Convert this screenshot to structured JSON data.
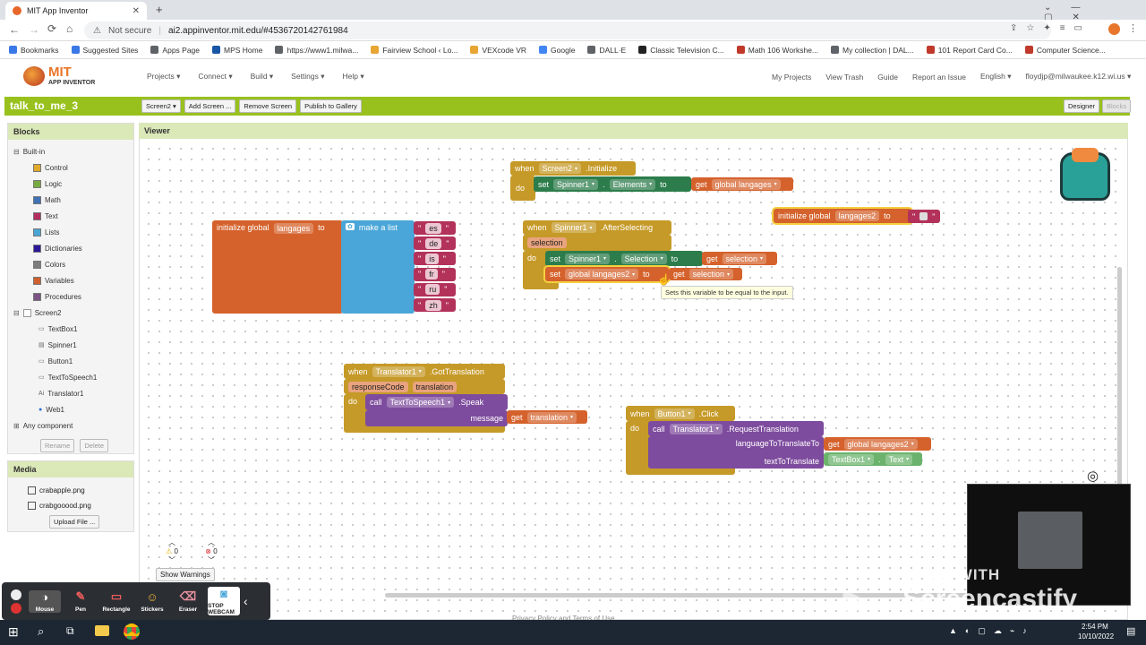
{
  "browser": {
    "tab_title": "MIT App Inventor",
    "security_label": "Not secure",
    "url": "ai2.appinventor.mit.edu/#4536720142761984",
    "bookmarks": [
      {
        "label": "Bookmarks",
        "color": "#3b78e7"
      },
      {
        "label": "Suggested Sites",
        "color": "#3b78e7"
      },
      {
        "label": "Apps Page",
        "color": "#5f6368"
      },
      {
        "label": "MPS Home",
        "color": "#1a56a6"
      },
      {
        "label": "https://www1.milwa...",
        "color": "#5f6368"
      },
      {
        "label": "Fairview School ‹ Lo...",
        "color": "#e7a534"
      },
      {
        "label": "VEXcode VR",
        "color": "#e7a534"
      },
      {
        "label": "Google",
        "color": "#4285f4"
      },
      {
        "label": "DALL·E",
        "color": "#5f6368"
      },
      {
        "label": "Classic Television C...",
        "color": "#222222"
      },
      {
        "label": "Math 106 Workshe...",
        "color": "#c0392b"
      },
      {
        "label": "My collection | DAL...",
        "color": "#5f6368"
      },
      {
        "label": "101 Report Card Co...",
        "color": "#c0392b"
      },
      {
        "label": "Computer Science...",
        "color": "#c0392b"
      }
    ]
  },
  "app": {
    "logo_line1": "MIT",
    "logo_line2": "APP INVENTOR",
    "menus": [
      "Projects ▾",
      "Connect ▾",
      "Build ▾",
      "Settings ▾",
      "Help ▾"
    ],
    "right_links": [
      "My Projects",
      "View Trash",
      "Guide",
      "Report an Issue",
      "English ▾",
      "floydjp@milwaukee.k12.wi.us ▾"
    ],
    "project_name": "talk_to_me_3",
    "screen_dropdown": "Screen2 ▾",
    "add_screen": "Add Screen ...",
    "remove_screen": "Remove Screen",
    "publish": "Publish to Gallery",
    "designer": "Designer",
    "blocks_btn": "Blocks"
  },
  "blocks_panel": {
    "title": "Blocks",
    "builtin": "Built-in",
    "builtin_items": [
      {
        "label": "Control",
        "color": "#e1a92a"
      },
      {
        "label": "Logic",
        "color": "#77ab41"
      },
      {
        "label": "Math",
        "color": "#3f71b5"
      },
      {
        "label": "Text",
        "color": "#b32d5e"
      },
      {
        "label": "Lists",
        "color": "#49a6d4"
      },
      {
        "label": "Dictionaries",
        "color": "#2d1799"
      },
      {
        "label": "Colors",
        "color": "#7d7d7d"
      },
      {
        "label": "Variables",
        "color": "#d05f2d"
      },
      {
        "label": "Procedures",
        "color": "#7c5385"
      }
    ],
    "screen": "Screen2",
    "screen_items": [
      "TextBox1",
      "Spinner1",
      "Button1",
      "TextToSpeech1",
      "Translator1",
      "Web1"
    ],
    "any_component": "Any component",
    "rename": "Rename",
    "delete": "Delete"
  },
  "media_panel": {
    "title": "Media",
    "files": [
      "crabapple.png",
      "crabgooood.png"
    ],
    "upload": "Upload File ..."
  },
  "viewer": {
    "title": "Viewer",
    "warn_count": "0",
    "error_count": "0",
    "show_warnings": "Show Warnings",
    "footer": "Privacy Policy and Terms of Use",
    "tooltip": "Sets this variable to be equal to the input."
  },
  "code_blocks": {
    "kw_when": "when",
    "kw_do": "do",
    "kw_set": "set",
    "kw_to": "to",
    "kw_get": "get",
    "kw_call": "call",
    "init_global": "initialize global",
    "var_langages": "langages",
    "var_langages2": "langages2",
    "make_list": "make a list",
    "langs": [
      "es",
      "de",
      "is",
      "fr",
      "ru",
      "zh"
    ],
    "screen2": "Screen2",
    "initialize": ".Initialize",
    "spinner1": "Spinner1",
    "elements": "Elements",
    "global_langages": "global langages",
    "after_selecting": ".AfterSelecting",
    "selection": "selection",
    "selection_prop": "Selection",
    "global_langages2": "global langages2",
    "translator1": "Translator1",
    "got_translation": ".GotTranslation",
    "response_code": "responseCode",
    "translation": "translation",
    "tts": "TextToSpeech1",
    "speak": ".Speak",
    "message": "message",
    "button1": "Button1",
    "click": ".Click",
    "request_translation": ".RequestTranslation",
    "lang_to_translate": "languageToTranslateTo",
    "text_to_translate": "textToTranslate",
    "textbox1": "TextBox1",
    "text_prop": "Text"
  },
  "recorder": {
    "tools": [
      "Mouse",
      "Pen",
      "Rectangle",
      "Stickers",
      "Eraser",
      "STOP WEBCAM"
    ],
    "watermark_line1": "MADE WITH",
    "watermark_line2": "Screencastify"
  },
  "taskbar": {
    "time": "2:54 PM",
    "date": "10/10/2022"
  }
}
